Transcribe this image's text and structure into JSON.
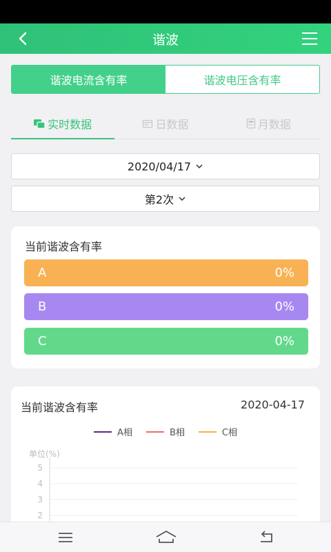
{
  "header": {
    "title": "谐波"
  },
  "segments": [
    {
      "label": "谐波电流含有率",
      "active": true
    },
    {
      "label": "谐波电压含有率",
      "active": false
    }
  ],
  "subtabs": [
    {
      "label": "实时数据",
      "icon": "realtime-data-icon",
      "active": true
    },
    {
      "label": "日数据",
      "icon": "calendar-day-icon",
      "active": false
    },
    {
      "label": "月数据",
      "icon": "calendar-month-icon",
      "active": false
    }
  ],
  "date_selector": {
    "value": "2020/04/17"
  },
  "count_selector": {
    "value": "第2次"
  },
  "current_card": {
    "title": "当前谐波含有率",
    "phases": [
      {
        "label": "A",
        "value": "0%",
        "color": "#f8b254"
      },
      {
        "label": "B",
        "value": "0%",
        "color": "#a788f1"
      },
      {
        "label": "C",
        "value": "0%",
        "color": "#62d98a"
      }
    ]
  },
  "chart_card": {
    "title": "当前谐波含有率",
    "date": "2020-04-17",
    "legend": [
      {
        "label": "A相",
        "color": "#5b2a86"
      },
      {
        "label": "B相",
        "color": "#ef6b6b"
      },
      {
        "label": "C相",
        "color": "#f4b43e"
      }
    ]
  },
  "chart_data": {
    "type": "line",
    "ylabel": "单位(%)",
    "yticks": [
      "5",
      "4",
      "3",
      "2"
    ],
    "ylim": [
      0,
      5
    ],
    "series": [
      {
        "name": "A相",
        "values": []
      },
      {
        "name": "B相",
        "values": []
      },
      {
        "name": "C相",
        "values": []
      }
    ]
  }
}
